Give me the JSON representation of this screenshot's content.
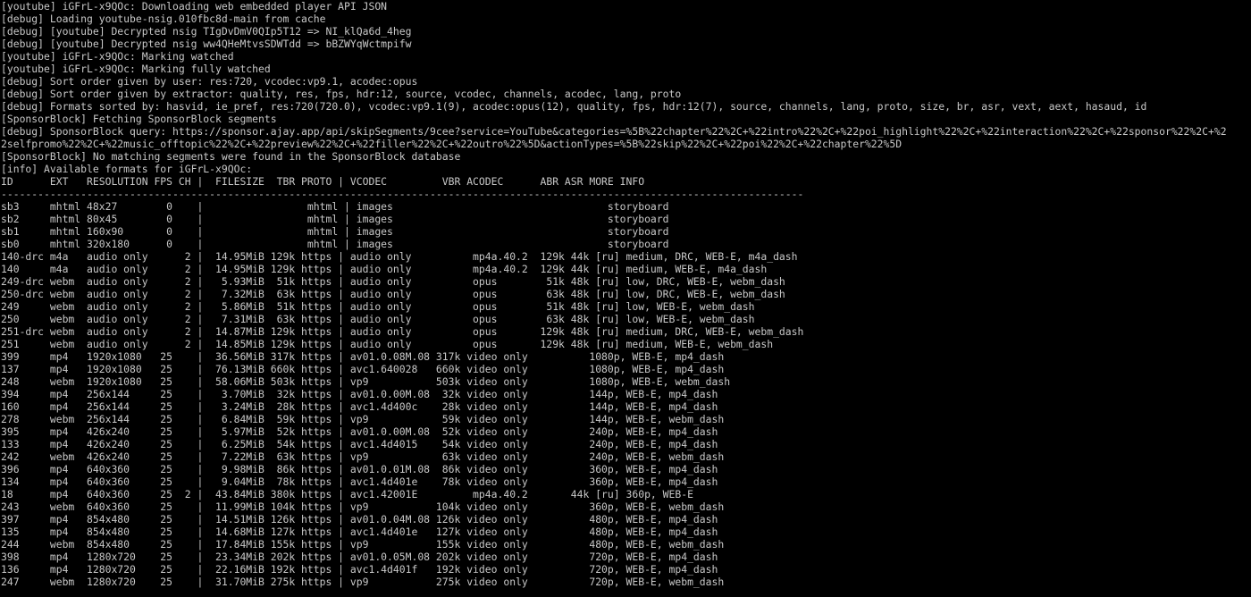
{
  "terminal": {
    "text_color": "#c8c8c8",
    "background_color": "#000000",
    "lines": [
      "[youtube] iGFrL-x9QOc: Downloading web embedded player API JSON",
      "[debug] Loading youtube-nsig.010fbc8d-main from cache",
      "[debug] [youtube] Decrypted nsig TIgDvDmV0QIp5T12 => NI_klQa6d_4heg",
      "[debug] [youtube] Decrypted nsig ww4QHeMtvsSDWTdd => bBZWYqWctmpifw",
      "[youtube] iGFrL-x9QOc: Marking watched",
      "[youtube] iGFrL-x9QOc: Marking fully watched",
      "[debug] Sort order given by user: res:720, vcodec:vp9.1, acodec:opus",
      "[debug] Sort order given by extractor: quality, res, fps, hdr:12, source, vcodec, channels, acodec, lang, proto",
      "[debug] Formats sorted by: hasvid, ie_pref, res:720(720.0), vcodec:vp9.1(9), acodec:opus(12), quality, fps, hdr:12(7), source, channels, lang, proto, size, br, asr, vext, aext, hasaud, id",
      "[SponsorBlock] Fetching SponsorBlock segments",
      "[debug] SponsorBlock query: https://sponsor.ajay.app/api/skipSegments/9cee?service=YouTube&categories=%5B%22chapter%22%2C+%22intro%22%2C+%22poi_highlight%22%2C+%22interaction%22%2C+%22sponsor%22%2C+%2",
      "2selfpromo%22%2C+%22music_offtopic%22%2C+%22preview%22%2C+%22filler%22%2C+%22outro%22%5D&actionTypes=%5B%22skip%22%2C+%22poi%22%2C+%22chapter%22%5D",
      "[SponsorBlock] No matching segments were found in the SponsorBlock database",
      "[info] Available formats for iGFrL-x9QOc:",
      "ID      EXT   RESOLUTION FPS CH |  FILESIZE  TBR PROTO | VCODEC         VBR ACODEC      ABR ASR MORE INFO",
      "-----------------------------------------------------------------------------------------------------------------------------------",
      "sb3     mhtml 48x27        0    |                 mhtml | images                                   storyboard",
      "sb2     mhtml 80x45        0    |                 mhtml | images                                   storyboard",
      "sb1     mhtml 160x90       0    |                 mhtml | images                                   storyboard",
      "sb0     mhtml 320x180      0    |                 mhtml | images                                   storyboard",
      "140-drc m4a   audio only      2 |  14.95MiB 129k https | audio only          mp4a.40.2  129k 44k [ru] medium, DRC, WEB-E, m4a_dash",
      "140     m4a   audio only      2 |  14.95MiB 129k https | audio only          mp4a.40.2  129k 44k [ru] medium, WEB-E, m4a_dash",
      "249-drc webm  audio only      2 |   5.93MiB  51k https | audio only          opus        51k 48k [ru] low, DRC, WEB-E, webm_dash",
      "250-drc webm  audio only      2 |   7.32MiB  63k https | audio only          opus        63k 48k [ru] low, DRC, WEB-E, webm_dash",
      "249     webm  audio only      2 |   5.86MiB  51k https | audio only          opus        51k 48k [ru] low, WEB-E, webm_dash",
      "250     webm  audio only      2 |   7.31MiB  63k https | audio only          opus        63k 48k [ru] low, WEB-E, webm_dash",
      "251-drc webm  audio only      2 |  14.87MiB 129k https | audio only          opus       129k 48k [ru] medium, DRC, WEB-E, webm_dash",
      "251     webm  audio only      2 |  14.85MiB 129k https | audio only          opus       129k 48k [ru] medium, WEB-E, webm_dash",
      "399     mp4   1920x1080   25    |  36.56MiB 317k https | av01.0.08M.08 317k video only          1080p, WEB-E, mp4_dash",
      "137     mp4   1920x1080   25    |  76.13MiB 660k https | avc1.640028   660k video only          1080p, WEB-E, mp4_dash",
      "248     webm  1920x1080   25    |  58.06MiB 503k https | vp9           503k video only          1080p, WEB-E, webm_dash",
      "394     mp4   256x144     25    |   3.70MiB  32k https | av01.0.00M.08  32k video only          144p, WEB-E, mp4_dash",
      "160     mp4   256x144     25    |   3.24MiB  28k https | avc1.4d400c    28k video only          144p, WEB-E, mp4_dash",
      "278     webm  256x144     25    |   6.84MiB  59k https | vp9            59k video only          144p, WEB-E, webm_dash",
      "395     mp4   426x240     25    |   5.97MiB  52k https | av01.0.00M.08  52k video only          240p, WEB-E, mp4_dash",
      "133     mp4   426x240     25    |   6.25MiB  54k https | avc1.4d4015    54k video only          240p, WEB-E, mp4_dash",
      "242     webm  426x240     25    |   7.22MiB  63k https | vp9            63k video only          240p, WEB-E, webm_dash",
      "396     mp4   640x360     25    |   9.98MiB  86k https | av01.0.01M.08  86k video only          360p, WEB-E, mp4_dash",
      "134     mp4   640x360     25    |   9.04MiB  78k https | avc1.4d401e    78k video only          360p, WEB-E, mp4_dash",
      "18      mp4   640x360     25  2 |  43.84MiB 380k https | avc1.42001E         mp4a.40.2       44k [ru] 360p, WEB-E",
      "243     webm  640x360     25    |  11.99MiB 104k https | vp9           104k video only          360p, WEB-E, webm_dash",
      "397     mp4   854x480     25    |  14.51MiB 126k https | av01.0.04M.08 126k video only          480p, WEB-E, mp4_dash",
      "135     mp4   854x480     25    |  14.68MiB 127k https | avc1.4d401e   127k video only          480p, WEB-E, mp4_dash",
      "244     webm  854x480     25    |  17.84MiB 155k https | vp9           155k video only          480p, WEB-E, webm_dash",
      "398     mp4   1280x720    25    |  23.34MiB 202k https | av01.0.05M.08 202k video only          720p, WEB-E, mp4_dash",
      "136     mp4   1280x720    25    |  22.16MiB 192k https | avc1.4d401f   192k video only          720p, WEB-E, mp4_dash",
      "247     webm  1280x720    25    |  31.70MiB 275k https | vp9           275k video only          720p, WEB-E, webm_dash"
    ]
  }
}
